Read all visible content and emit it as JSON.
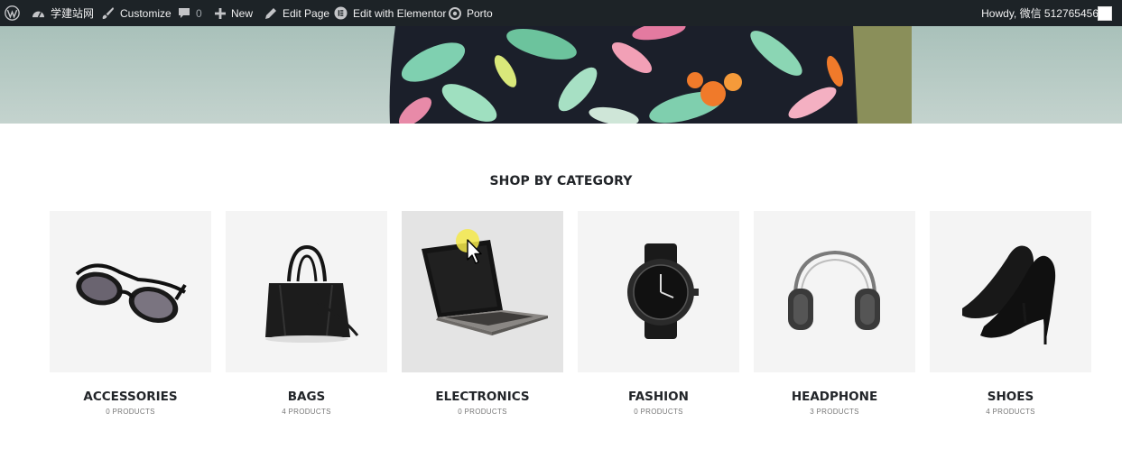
{
  "admin_bar": {
    "site_name": "学建站网",
    "customize": "Customize",
    "comments_count": "0",
    "new": "New",
    "edit_page": "Edit Page",
    "edit_elementor": "Edit with Elementor",
    "theme": "Porto",
    "howdy": "Howdy, 微信 512765456"
  },
  "section": {
    "title": "SHOP BY CATEGORY"
  },
  "categories": [
    {
      "name": "ACCESSORIES",
      "count": "0 PRODUCTS",
      "icon": "sunglasses-icon"
    },
    {
      "name": "BAGS",
      "count": "4 PRODUCTS",
      "icon": "handbag-icon"
    },
    {
      "name": "ELECTRONICS",
      "count": "0 PRODUCTS",
      "icon": "laptop-icon"
    },
    {
      "name": "FASHION",
      "count": "0 PRODUCTS",
      "icon": "watch-icon"
    },
    {
      "name": "HEADPHONE",
      "count": "3 PRODUCTS",
      "icon": "headphone-icon"
    },
    {
      "name": "SHOES",
      "count": "4 PRODUCTS",
      "icon": "high-heels-icon"
    }
  ],
  "colors": {
    "admin_bar_bg": "#1d2327",
    "heading": "#222529",
    "tile_bg": "#f4f4f4",
    "tile_hover_bg": "#e4e4e4",
    "hero_bg": "#b8cbc5"
  }
}
